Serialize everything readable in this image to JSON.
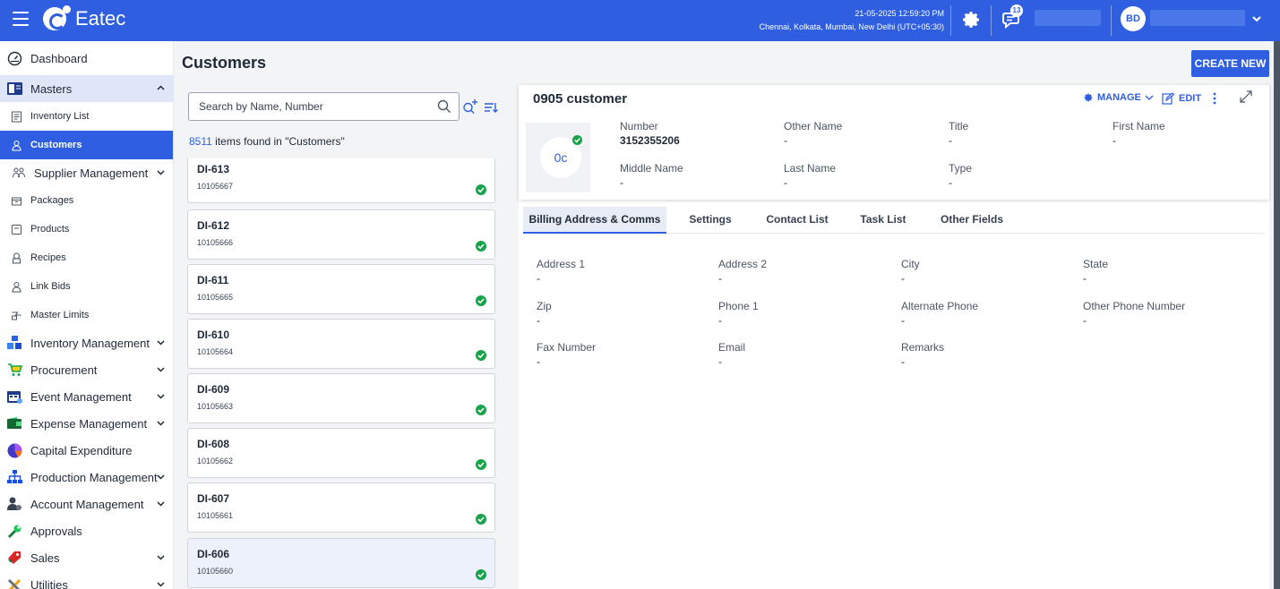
{
  "app": {
    "name": "Eatec"
  },
  "header": {
    "datetime": "21-05-2025 12:59:20 PM",
    "timezone": "Chennai, Kolkata, Mumbai, New Delhi (UTC+05:30)",
    "notification_count": "13",
    "user_initials": "BD",
    "accent_color": "#2f5fe0"
  },
  "sidebar": {
    "items": [
      {
        "label": "Dashboard",
        "icon": "gauge-icon"
      },
      {
        "label": "Masters",
        "icon": "masters-icon"
      },
      {
        "label": "Inventory List",
        "icon": "inventory-list-icon"
      },
      {
        "label": "Customers",
        "icon": "customer-icon"
      },
      {
        "label": "Supplier Management",
        "icon": "supplier-icon"
      },
      {
        "label": "Packages",
        "icon": "package-icon"
      },
      {
        "label": "Products",
        "icon": "product-icon"
      },
      {
        "label": "Recipes",
        "icon": "recipe-icon"
      },
      {
        "label": "Link Bids",
        "icon": "link-bids-icon"
      },
      {
        "label": "Master Limits",
        "icon": "limits-icon"
      },
      {
        "label": "Inventory Management",
        "icon": "boxes-icon"
      },
      {
        "label": "Procurement",
        "icon": "cart-icon"
      },
      {
        "label": "Event Management",
        "icon": "calendar-icon"
      },
      {
        "label": "Expense Management",
        "icon": "wallet-icon"
      },
      {
        "label": "Capital Expenditure",
        "icon": "pie-icon"
      },
      {
        "label": "Production Management",
        "icon": "hierarchy-icon"
      },
      {
        "label": "Account Management",
        "icon": "account-icon"
      },
      {
        "label": "Approvals",
        "icon": "wrench-icon"
      },
      {
        "label": "Sales",
        "icon": "tag-icon"
      },
      {
        "label": "Utilities",
        "icon": "tools-icon"
      }
    ]
  },
  "page": {
    "title": "Customers",
    "create_label": "CREATE NEW"
  },
  "list": {
    "search_placeholder": "Search by Name, Number",
    "found_count": "8511",
    "found_text": " items found in \"Customers\"",
    "items": [
      {
        "id": "DI-613",
        "number": "10105667"
      },
      {
        "id": "DI-612",
        "number": "10105666"
      },
      {
        "id": "DI-611",
        "number": "10105665"
      },
      {
        "id": "DI-610",
        "number": "10105664"
      },
      {
        "id": "DI-609",
        "number": "10105663"
      },
      {
        "id": "DI-608",
        "number": "10105662"
      },
      {
        "id": "DI-607",
        "number": "10105661"
      },
      {
        "id": "DI-606",
        "number": "10105660"
      }
    ]
  },
  "detail": {
    "name": "0905 customer",
    "manage_label": "MANAGE",
    "edit_label": "EDIT",
    "avatar_text": "0c",
    "fields": {
      "number": {
        "label": "Number",
        "value": "3152355206"
      },
      "other_name": {
        "label": "Other Name",
        "value": "-"
      },
      "title": {
        "label": "Title",
        "value": "-"
      },
      "first_name": {
        "label": "First Name",
        "value": "-"
      },
      "middle_name": {
        "label": "Middle Name",
        "value": "-"
      },
      "last_name": {
        "label": "Last Name",
        "value": "-"
      },
      "type": {
        "label": "Type",
        "value": "-"
      }
    },
    "tabs": [
      "Billing Address & Comms",
      "Settings",
      "Contact List",
      "Task List",
      "Other Fields"
    ],
    "billing": {
      "address1": {
        "label": "Address 1",
        "value": "-"
      },
      "address2": {
        "label": "Address 2",
        "value": "-"
      },
      "city": {
        "label": "City",
        "value": "-"
      },
      "state": {
        "label": "State",
        "value": "-"
      },
      "zip": {
        "label": "Zip",
        "value": "-"
      },
      "phone1": {
        "label": "Phone 1",
        "value": "-"
      },
      "alt_phone": {
        "label": "Alternate Phone",
        "value": "-"
      },
      "other_phone": {
        "label": "Other Phone Number",
        "value": "-"
      },
      "fax": {
        "label": "Fax Number",
        "value": "-"
      },
      "email": {
        "label": "Email",
        "value": "-"
      },
      "remarks": {
        "label": "Remarks",
        "value": "-"
      }
    }
  }
}
